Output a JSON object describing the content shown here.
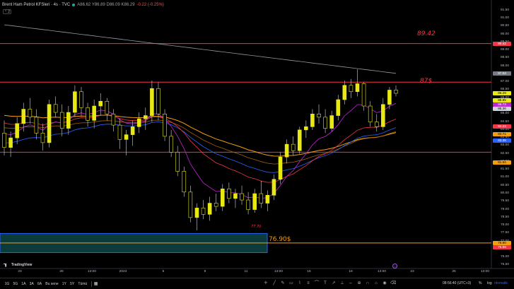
{
  "header": {
    "symbol": "Brent Ham Petrol KFSleri · 4s · TVC",
    "ohlc": "A86.62 Y86.89 D86.09 K86.29",
    "change": "-0.22 (-0.25%)",
    "collapse": "2"
  },
  "price_axis": {
    "ticks": [
      "91.50",
      "91.00",
      "90.50",
      "90.00",
      "89.50",
      "89.00",
      "88.50",
      "88.00",
      "87.50",
      "87.00",
      "86.50",
      "86.00",
      "85.50",
      "85.00",
      "84.50",
      "84.00",
      "83.50",
      "83.00",
      "82.50",
      "82.00",
      "81.50",
      "81.00",
      "80.50",
      "80.00",
      "79.50",
      "79.00",
      "78.50",
      "78.00",
      "77.50",
      "77.00",
      "76.50",
      "76.00",
      "75.50"
    ],
    "labels": [
      {
        "text": "89.42",
        "color": "#f23645",
        "value": 89.42
      },
      {
        "text": "87.53",
        "color": "#787b86",
        "value": 87.53
      },
      {
        "text": "86.29",
        "color": "#e8e812",
        "value": 86.29
      },
      {
        "text": "85.85",
        "color": "#e8e812",
        "value": 85.85
      },
      {
        "text": "85.73",
        "color": "#c026d3",
        "value": 85.73
      },
      {
        "text": "85.36",
        "color": "#d1d4dc",
        "value": 85.36
      },
      {
        "text": "84.23",
        "color": "#f23645",
        "value": 84.23
      },
      {
        "text": "83.71",
        "color": "#f59e0b",
        "value": 83.71
      },
      {
        "text": "83.35",
        "color": "#2962ff",
        "value": 83.35
      },
      {
        "text": "81.94",
        "color": "#f59e0b",
        "value": 81.94
      },
      {
        "text": "76.90",
        "color": "#f59e0b",
        "value": 76.9
      },
      {
        "text": "76.89",
        "color": "#f23645",
        "value": 76.89
      }
    ]
  },
  "time_axis": [
    "23",
    "28",
    "13:00",
    "2023",
    "5",
    "9",
    "11",
    "13:00",
    "16",
    "18",
    "13:00",
    "23",
    "25",
    "13:00"
  ],
  "annotations": {
    "level_high": "89.42",
    "level_mid": "87$",
    "level_low": "76.90$",
    "low_point": "77.70"
  },
  "levels": {
    "high": 89.42,
    "mid": 87.0,
    "support": 82.6,
    "low": 76.9
  },
  "zone": {
    "top": 77.5,
    "bottom": 76.3,
    "color": "#0b3b3b",
    "border": "#2962ff"
  },
  "colors": {
    "candle": "#e8e812",
    "level_line": "#f23645",
    "ema_fast": "#c026d3",
    "ema_mid": "#a16207",
    "ema_slow": "#f59e0b",
    "ema_red": "#f23645",
    "ema_blue": "#2962ff",
    "sma_long": "#9598a1"
  },
  "bottom_bar": {
    "timeframes": [
      "1G",
      "5G",
      "1A",
      "3A",
      "6A",
      "Bu sene",
      "1Y",
      "5Y",
      "Tümü"
    ],
    "clock": "08:56:40 (UTC+3)",
    "percent": "%",
    "log": "log",
    "auto": "otomatik"
  },
  "watermark": "TradingView",
  "chart_data": {
    "type": "candlestick",
    "ylim": [
      75.3,
      91.8
    ],
    "candles": [
      [
        83.8,
        84.6,
        82.4,
        82.9
      ],
      [
        82.9,
        83.9,
        82.3,
        83.5
      ],
      [
        83.5,
        84.8,
        83.1,
        84.4
      ],
      [
        84.4,
        85.7,
        83.9,
        85.3
      ],
      [
        85.3,
        86.0,
        84.4,
        84.8
      ],
      [
        84.8,
        85.3,
        83.4,
        83.8
      ],
      [
        83.8,
        84.4,
        82.7,
        83.2
      ],
      [
        83.2,
        85.9,
        82.9,
        85.6
      ],
      [
        85.6,
        86.1,
        84.8,
        85.1
      ],
      [
        85.1,
        85.6,
        83.6,
        84.1
      ],
      [
        84.1,
        85.5,
        83.7,
        85.1
      ],
      [
        85.1,
        86.8,
        84.8,
        86.4
      ],
      [
        86.4,
        86.7,
        84.9,
        85.4
      ],
      [
        85.4,
        85.7,
        84.2,
        84.6
      ],
      [
        84.6,
        85.9,
        84.1,
        85.5
      ],
      [
        85.5,
        86.3,
        84.9,
        85.8
      ],
      [
        85.8,
        86.0,
        84.6,
        85.0
      ],
      [
        85.0,
        85.3,
        83.9,
        84.3
      ],
      [
        84.3,
        84.7,
        82.8,
        83.4
      ],
      [
        83.4,
        84.0,
        82.4,
        83.7
      ],
      [
        83.7,
        84.6,
        83.0,
        84.2
      ],
      [
        84.2,
        85.1,
        83.8,
        84.7
      ],
      [
        84.7,
        85.4,
        84.0,
        84.9
      ],
      [
        84.9,
        87.1,
        84.5,
        86.6
      ],
      [
        86.6,
        87.0,
        84.6,
        85.0
      ],
      [
        85.0,
        85.3,
        83.3,
        83.6
      ],
      [
        83.6,
        84.0,
        82.3,
        82.6
      ],
      [
        82.6,
        83.0,
        81.1,
        81.4
      ],
      [
        81.4,
        81.7,
        79.8,
        80.1
      ],
      [
        80.1,
        80.5,
        78.2,
        78.5
      ],
      [
        78.5,
        79.4,
        77.7,
        79.1
      ],
      [
        79.1,
        79.6,
        78.4,
        78.7
      ],
      [
        78.7,
        79.8,
        78.3,
        79.4
      ],
      [
        79.4,
        80.0,
        78.9,
        79.2
      ],
      [
        79.2,
        80.6,
        78.9,
        80.3
      ],
      [
        80.3,
        80.7,
        79.4,
        79.7
      ],
      [
        79.7,
        80.3,
        79.1,
        80.0
      ],
      [
        80.0,
        80.5,
        79.3,
        79.6
      ],
      [
        79.6,
        80.1,
        78.7,
        79.0
      ],
      [
        79.0,
        80.3,
        78.8,
        80.0
      ],
      [
        80.0,
        80.8,
        79.1,
        79.4
      ],
      [
        79.4,
        80.2,
        78.9,
        79.9
      ],
      [
        79.9,
        81.2,
        79.6,
        80.9
      ],
      [
        80.9,
        82.6,
        80.6,
        82.3
      ],
      [
        82.3,
        83.4,
        81.9,
        83.1
      ],
      [
        83.1,
        83.6,
        82.4,
        82.7
      ],
      [
        82.7,
        84.2,
        82.5,
        84.0
      ],
      [
        84.0,
        84.6,
        83.5,
        84.2
      ],
      [
        84.2,
        85.3,
        84.0,
        85.0
      ],
      [
        85.0,
        85.6,
        84.4,
        84.8
      ],
      [
        84.8,
        85.3,
        83.8,
        84.1
      ],
      [
        84.1,
        85.2,
        83.9,
        84.9
      ],
      [
        84.9,
        86.2,
        84.6,
        85.9
      ],
      [
        85.9,
        87.1,
        85.6,
        86.8
      ],
      [
        86.8,
        87.2,
        86.0,
        86.4
      ],
      [
        86.4,
        87.8,
        86.1,
        86.9
      ],
      [
        86.9,
        87.0,
        85.2,
        85.5
      ],
      [
        85.5,
        85.8,
        84.2,
        84.5
      ],
      [
        84.5,
        85.0,
        83.9,
        84.2
      ],
      [
        84.2,
        86.0,
        84.0,
        85.6
      ],
      [
        85.6,
        86.7,
        85.3,
        86.5
      ],
      [
        86.5,
        86.8,
        86.1,
        86.3
      ]
    ]
  }
}
